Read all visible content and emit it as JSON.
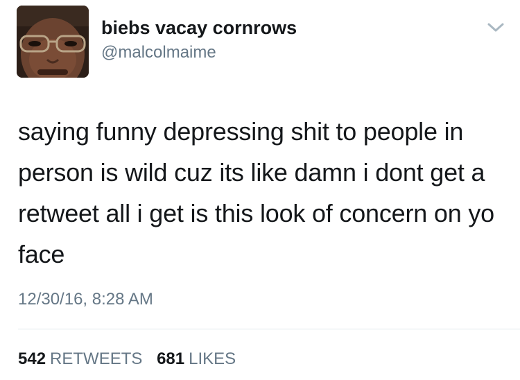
{
  "user": {
    "display_name": "biebs vacay cornrows",
    "handle": "@malcolmaime"
  },
  "tweet": {
    "text": "saying funny depressing shit to people in person is wild cuz its like damn i dont get a retweet all i get is this look of concern on yo face",
    "timestamp": "12/30/16, 8:28 AM"
  },
  "stats": {
    "retweets_count": "542",
    "retweets_label": "RETWEETS",
    "likes_count": "681",
    "likes_label": "LIKES"
  },
  "icons": {
    "menu": "chevron-down-icon"
  },
  "colors": {
    "primary_text": "#14171a",
    "secondary_text": "#657786",
    "divider": "#e1e8ed"
  }
}
